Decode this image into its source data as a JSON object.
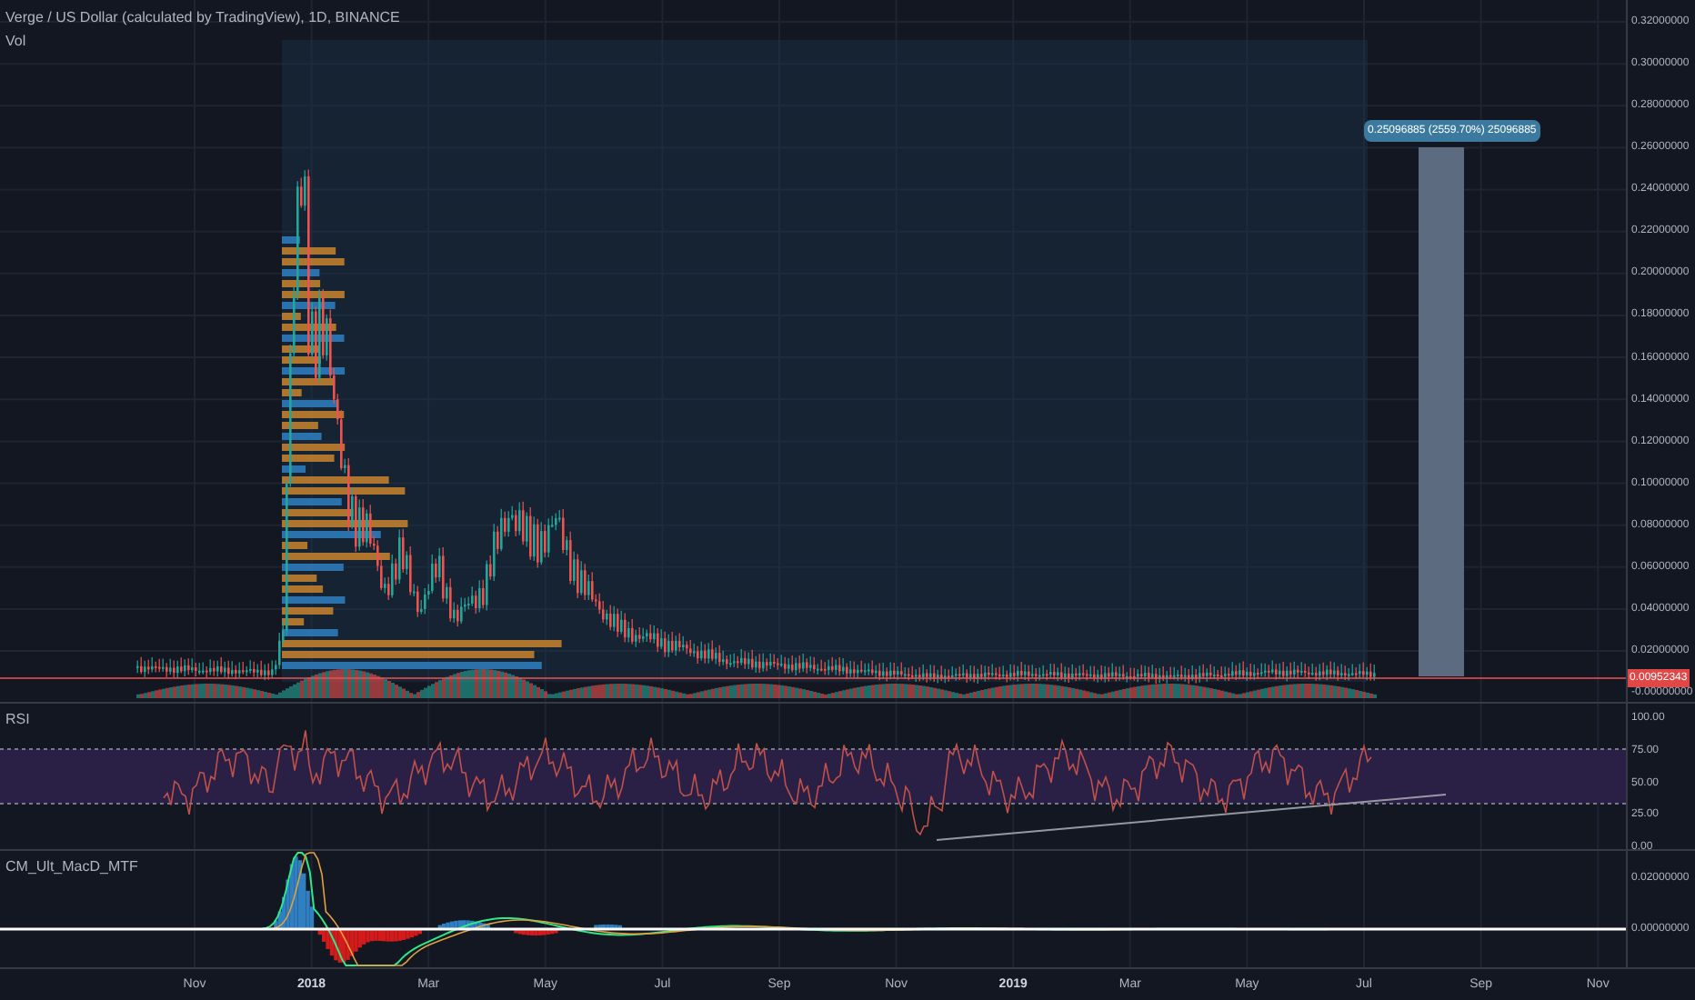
{
  "legend": {
    "title": "Verge / US Dollar (calculated by TradingView), 1D, BINANCE",
    "volume_label": "Vol"
  },
  "price_axis": {
    "ticks": [
      "0.32000000",
      "0.30000000",
      "0.28000000",
      "0.26000000",
      "0.24000000",
      "0.22000000",
      "0.20000000",
      "0.18000000",
      "0.16000000",
      "0.14000000",
      "0.12000000",
      "0.10000000",
      "0.08000000",
      "0.06000000",
      "0.04000000",
      "0.02000000"
    ],
    "last_price": "0.00952343",
    "zero_label": "-0.00000000"
  },
  "measure": {
    "label": "0.25096885 (2559.70%) 25096885"
  },
  "rsi": {
    "title": "RSI",
    "ticks": [
      "100.00",
      "75.00",
      "50.00",
      "25.00",
      "0.00"
    ]
  },
  "macd": {
    "title": "CM_Ult_MacD_MTF",
    "ticks": [
      "0.02000000",
      "0.00000000"
    ]
  },
  "time_axis": [
    {
      "label": "Nov",
      "kind": "month"
    },
    {
      "label": "2018",
      "kind": "year"
    },
    {
      "label": "Mar",
      "kind": "month"
    },
    {
      "label": "May",
      "kind": "month"
    },
    {
      "label": "Jul",
      "kind": "month"
    },
    {
      "label": "Sep",
      "kind": "month"
    },
    {
      "label": "Nov",
      "kind": "month"
    },
    {
      "label": "2019",
      "kind": "year"
    },
    {
      "label": "Mar",
      "kind": "month"
    },
    {
      "label": "May",
      "kind": "month"
    },
    {
      "label": "Jul",
      "kind": "month"
    },
    {
      "label": "Sep",
      "kind": "month"
    },
    {
      "label": "Nov",
      "kind": "month"
    }
  ]
}
